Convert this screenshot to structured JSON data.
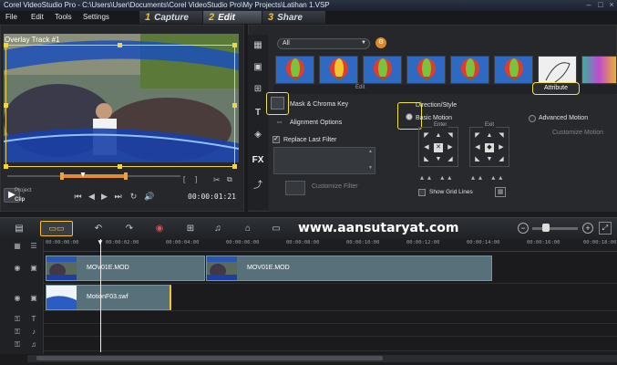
{
  "window": {
    "title": "Corel VideoStudio Pro - C:\\Users\\User\\Documents\\Corel VideoStudio Pro\\My Projects\\Latihan 1.VSP"
  },
  "menu": [
    "File",
    "Edit",
    "Tools",
    "Settings"
  ],
  "steps": [
    {
      "num": "1",
      "label": "Capture"
    },
    {
      "num": "2",
      "label": "Edit"
    },
    {
      "num": "3",
      "label": "Share"
    }
  ],
  "preview": {
    "overlay_label": "Overlay Track #1",
    "project_label": "Project",
    "clip_label": "Clip",
    "timecode": "00:00:01:21"
  },
  "library": {
    "filter_value": "All",
    "tabs": {
      "edit": "Edit",
      "attribute": "Attribute"
    }
  },
  "options": {
    "mask_chroma": "Mask & Chroma Key",
    "alignment": "Alignment Options",
    "replace_filter": "Replace Last Filter",
    "customize_filter": "Customize Filter",
    "motion_style": "Direction/Style",
    "basic_motion": "Basic Motion",
    "enter": "Enter",
    "exit": "Exit",
    "advanced_motion": "Advanced Motion",
    "customize_motion": "Customize Motion",
    "show_grid": "Show Grid Lines"
  },
  "timeline": {
    "url": "www.aansutaryat.com",
    "ticks": [
      "00:00:00:00",
      "00:00:02:00",
      "00:00:04:00",
      "00:00:06:00",
      "00:00:08:00",
      "00:00:10:00",
      "00:00:12:00",
      "00:00:14:00",
      "00:00:16:00",
      "00:00:18:00"
    ],
    "video_clips": [
      "MOV01E.MOD",
      "MOV01E.MOD"
    ],
    "overlay_clip": "MotionF03.swf"
  },
  "colors": {
    "accent": "#f2c233",
    "highlight": "#f2e33a",
    "clip": "#58707a"
  }
}
